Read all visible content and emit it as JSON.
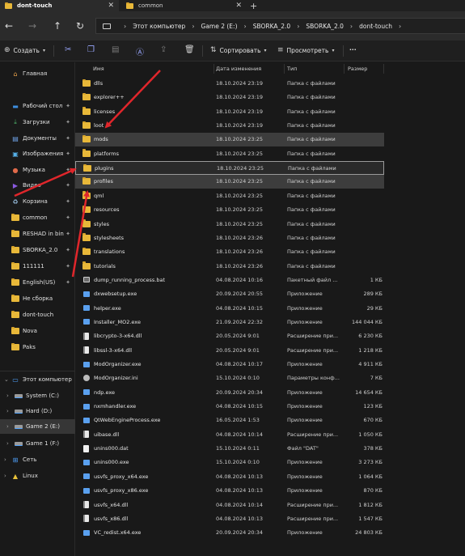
{
  "tabs": [
    {
      "label": "dont-touch",
      "active": true
    },
    {
      "label": "common",
      "active": false
    }
  ],
  "address": {
    "crumbs": [
      "Этот компьютер",
      "Game 2 (E:)",
      "SBORKA_2.0",
      "SBORKA_2.0",
      "dont-touch"
    ]
  },
  "toolbar": {
    "create_label": "Создать",
    "sort_label": "Сортировать",
    "view_label": "Просмотреть",
    "more_label": "···"
  },
  "sidebar": {
    "home": "Главная",
    "quick": [
      {
        "label": "Рабочий стол",
        "icon": "desktop-icon"
      },
      {
        "label": "Загрузки",
        "icon": "download-icon"
      },
      {
        "label": "Документы",
        "icon": "documents-icon"
      },
      {
        "label": "Изображения",
        "icon": "pictures-icon"
      },
      {
        "label": "Музыка",
        "icon": "music-icon"
      },
      {
        "label": "Видео",
        "icon": "video-icon"
      },
      {
        "label": "Корзина",
        "icon": "recycle-bin-icon"
      },
      {
        "label": "common",
        "icon": "folder-icon"
      },
      {
        "label": "RESHAD in bin",
        "icon": "folder-icon"
      },
      {
        "label": "SBORKA_2.0",
        "icon": "folder-icon"
      },
      {
        "label": "111111",
        "icon": "folder-icon"
      },
      {
        "label": "English(US)",
        "icon": "folder-icon"
      },
      {
        "label": "Не сборка",
        "icon": "folder-icon"
      },
      {
        "label": "dont-touch",
        "icon": "folder-icon"
      },
      {
        "label": "Nova",
        "icon": "folder-icon"
      },
      {
        "label": "Paks",
        "icon": "folder-icon"
      }
    ],
    "this_pc": "Этот компьютер",
    "drives": [
      "System (C:)",
      "Hard (D:)",
      "Game 2 (E:)",
      "Game 1 (F:)"
    ],
    "network": "Сеть",
    "linux": "Linux"
  },
  "columns": {
    "name": "Имя",
    "date": "Дата изменения",
    "type": "Тип",
    "size": "Размер"
  },
  "files": [
    {
      "name": "dlls",
      "date": "18.10.2024 23:19",
      "type": "Папка с файлами",
      "size": "",
      "icon": "folder"
    },
    {
      "name": "explorer++",
      "date": "18.10.2024 23:19",
      "type": "Папка с файлами",
      "size": "",
      "icon": "folder"
    },
    {
      "name": "licenses",
      "date": "18.10.2024 23:19",
      "type": "Папка с файлами",
      "size": "",
      "icon": "folder"
    },
    {
      "name": "loot",
      "date": "18.10.2024 23:19",
      "type": "Папка с файлами",
      "size": "",
      "icon": "folder"
    },
    {
      "name": "mods",
      "date": "18.10.2024 23:25",
      "type": "Папка с файлами",
      "size": "",
      "icon": "folder"
    },
    {
      "name": "platforms",
      "date": "18.10.2024 23:25",
      "type": "Папка с файлами",
      "size": "",
      "icon": "folder"
    },
    {
      "name": "plugins",
      "date": "18.10.2024 23:25",
      "type": "Папка с файлами",
      "size": "",
      "icon": "folder"
    },
    {
      "name": "profiles",
      "date": "18.10.2024 23:25",
      "type": "Папка с файлами",
      "size": "",
      "icon": "folder"
    },
    {
      "name": "qml",
      "date": "18.10.2024 23:25",
      "type": "Папка с файлами",
      "size": "",
      "icon": "folder"
    },
    {
      "name": "resources",
      "date": "18.10.2024 23:25",
      "type": "Папка с файлами",
      "size": "",
      "icon": "folder"
    },
    {
      "name": "styles",
      "date": "18.10.2024 23:25",
      "type": "Папка с файлами",
      "size": "",
      "icon": "folder"
    },
    {
      "name": "stylesheets",
      "date": "18.10.2024 23:26",
      "type": "Папка с файлами",
      "size": "",
      "icon": "folder"
    },
    {
      "name": "translations",
      "date": "18.10.2024 23:26",
      "type": "Папка с файлами",
      "size": "",
      "icon": "folder"
    },
    {
      "name": "tutorials",
      "date": "18.10.2024 23:26",
      "type": "Папка с файлами",
      "size": "",
      "icon": "folder"
    },
    {
      "name": "dump_running_process.bat",
      "date": "04.08.2024 10:16",
      "type": "Пакетный файл ...",
      "size": "1 КБ",
      "icon": "bat"
    },
    {
      "name": "dxwebsetup.exe",
      "date": "20.09.2024 20:55",
      "type": "Приложение",
      "size": "289 КБ",
      "icon": "exe"
    },
    {
      "name": "helper.exe",
      "date": "04.08.2024 10:15",
      "type": "Приложение",
      "size": "29 КБ",
      "icon": "exe"
    },
    {
      "name": "Installer_MO2.exe",
      "date": "21.09.2024 22:32",
      "type": "Приложение",
      "size": "144 044 КБ",
      "icon": "exe"
    },
    {
      "name": "libcrypto-3-x64.dll",
      "date": "20.05.2024 9:01",
      "type": "Расширение при...",
      "size": "6 230 КБ",
      "icon": "dll"
    },
    {
      "name": "libssl-3-x64.dll",
      "date": "20.05.2024 9:01",
      "type": "Расширение при...",
      "size": "1 218 КБ",
      "icon": "dll"
    },
    {
      "name": "ModOrganizer.exe",
      "date": "04.08.2024 10:17",
      "type": "Приложение",
      "size": "4 911 КБ",
      "icon": "exe"
    },
    {
      "name": "ModOrganizer.ini",
      "date": "15.10.2024 0:10",
      "type": "Параметры конф...",
      "size": "7 КБ",
      "icon": "gear"
    },
    {
      "name": "ndp.exe",
      "date": "20.09.2024 20:34",
      "type": "Приложение",
      "size": "14 654 КБ",
      "icon": "exe"
    },
    {
      "name": "nxmhandler.exe",
      "date": "04.08.2024 10:15",
      "type": "Приложение",
      "size": "123 КБ",
      "icon": "exe"
    },
    {
      "name": "QtWebEngineProcess.exe",
      "date": "16.05.2024 1:53",
      "type": "Приложение",
      "size": "670 КБ",
      "icon": "exe"
    },
    {
      "name": "uibase.dll",
      "date": "04.08.2024 10:14",
      "type": "Расширение при...",
      "size": "1 050 КБ",
      "icon": "dll"
    },
    {
      "name": "unins000.dat",
      "date": "15.10.2024 0:11",
      "type": "Файл \"DAT\"",
      "size": "378 КБ",
      "icon": "doc"
    },
    {
      "name": "unins000.exe",
      "date": "15.10.2024 0:10",
      "type": "Приложение",
      "size": "3 273 КБ",
      "icon": "exe"
    },
    {
      "name": "usvfs_proxy_x64.exe",
      "date": "04.08.2024 10:13",
      "type": "Приложение",
      "size": "1 064 КБ",
      "icon": "exe"
    },
    {
      "name": "usvfs_proxy_x86.exe",
      "date": "04.08.2024 10:13",
      "type": "Приложение",
      "size": "870 КБ",
      "icon": "exe"
    },
    {
      "name": "usvfs_x64.dll",
      "date": "04.08.2024 10:14",
      "type": "Расширение при...",
      "size": "1 812 КБ",
      "icon": "dll"
    },
    {
      "name": "usvfs_x86.dll",
      "date": "04.08.2024 10:13",
      "type": "Расширение при...",
      "size": "1 547 КБ",
      "icon": "dll"
    },
    {
      "name": "VC_redist.x64.exe",
      "date": "20.09.2024 20:34",
      "type": "Приложение",
      "size": "24 803 КБ",
      "icon": "exe"
    }
  ],
  "highlighted_rows": [
    "mods",
    "plugins",
    "profiles"
  ],
  "annotation_color": "#e0262b"
}
